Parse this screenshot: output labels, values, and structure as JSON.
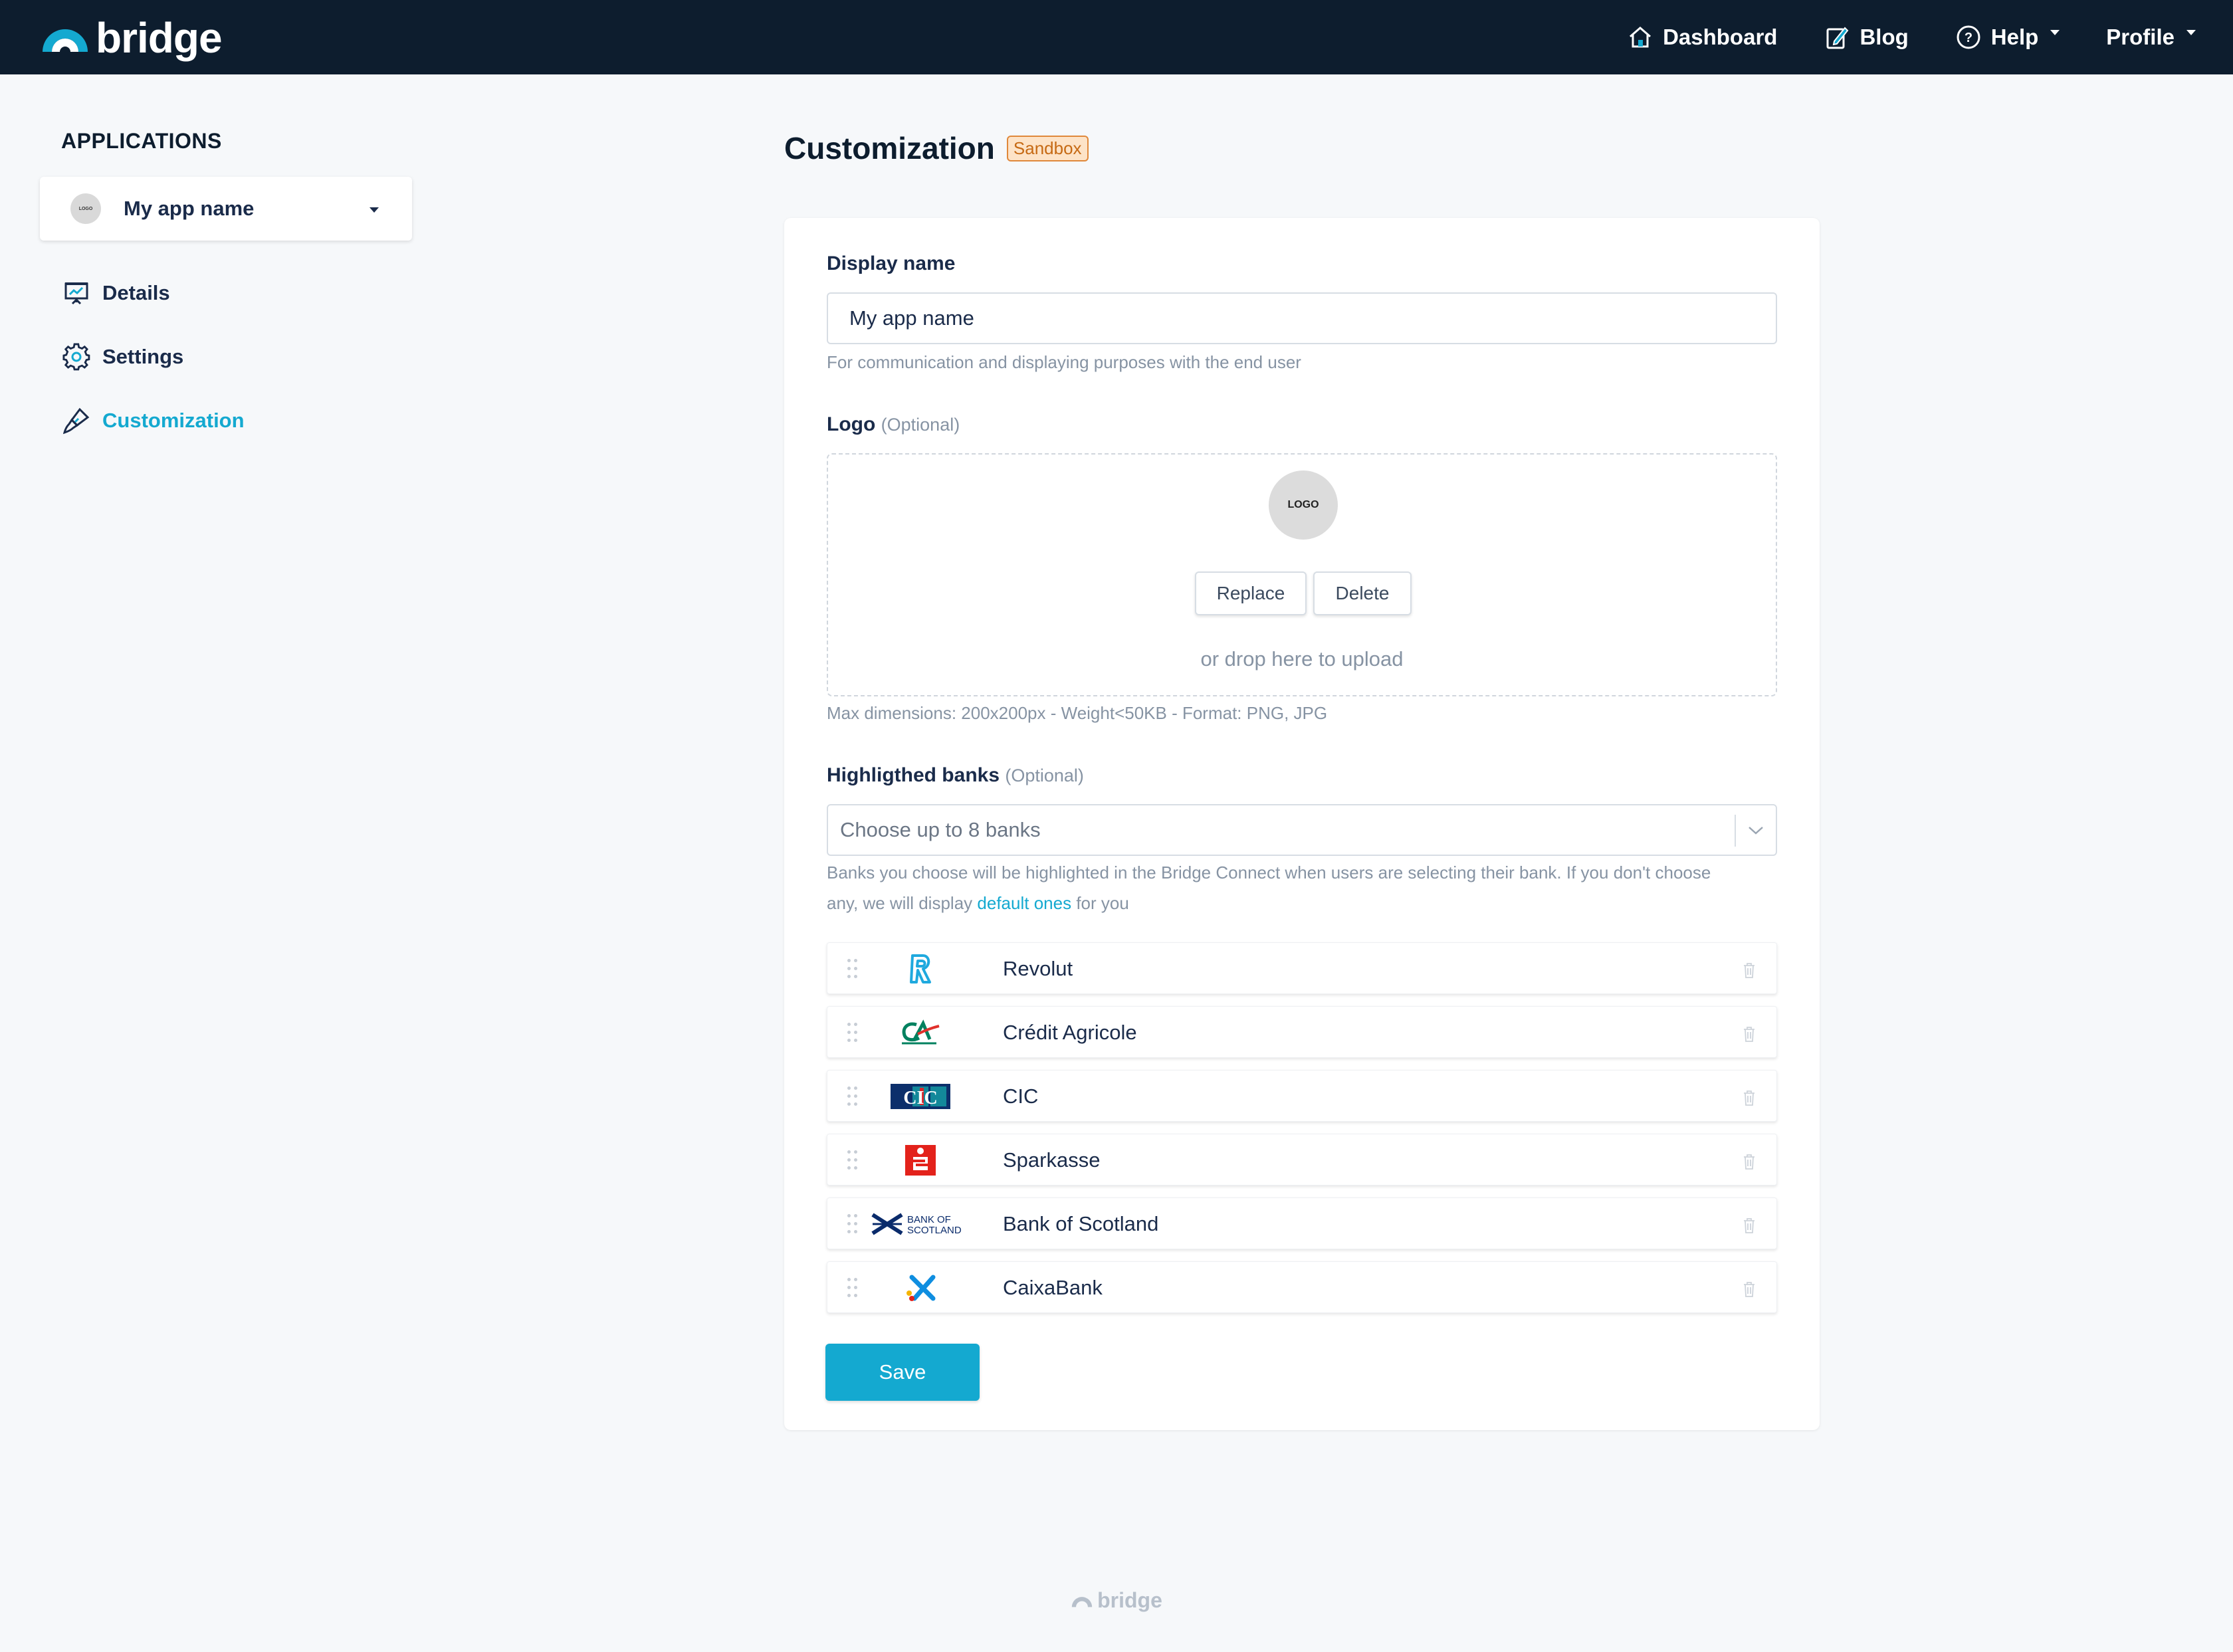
{
  "brand": {
    "name": "bridge"
  },
  "nav": {
    "dashboard": "Dashboard",
    "blog": "Blog",
    "help": "Help",
    "profile": "Profile"
  },
  "sidebar": {
    "heading": "APPLICATIONS",
    "app_logo_text": "LOGO",
    "selected_app": "My app name",
    "links": {
      "details": "Details",
      "settings": "Settings",
      "customization": "Customization"
    },
    "active": "Customization"
  },
  "page": {
    "title": "Customization",
    "badge": "Sandbox"
  },
  "form": {
    "display_name": {
      "label": "Display name",
      "value": "My app name",
      "help": "For communication and displaying purposes with the end user"
    },
    "logo": {
      "label": "Logo",
      "optional": "(Optional)",
      "placeholder_text": "LOGO",
      "replace": "Replace",
      "delete": "Delete",
      "drop_text": "or drop here to upload",
      "help": "Max dimensions: 200x200px - Weight<50KB - Format: PNG, JPG"
    },
    "banks": {
      "label": "Highligthed banks",
      "optional": "(Optional)",
      "placeholder": "Choose up to 8 banks",
      "help_line1": "Banks you choose will be highlighted in the Bridge Connect when users are selecting their bank. If you don't choose",
      "help_line2_pre": "any, we will display",
      "help_link": "default ones",
      "help_line2_post": "for you",
      "items": [
        {
          "name": "Revolut"
        },
        {
          "name": "Crédit Agricole"
        },
        {
          "name": "CIC",
          "logo_text": "CIC"
        },
        {
          "name": "Sparkasse"
        },
        {
          "name": "Bank of Scotland",
          "logo_text_1": "BANK OF",
          "logo_text_2": "SCOTLAND"
        },
        {
          "name": "CaixaBank"
        }
      ]
    },
    "save": "Save"
  },
  "footer": {
    "text": "bridge"
  },
  "colors": {
    "accent": "#14a9d0",
    "nav_bg": "#0d1d2e",
    "badge_border": "#e0883a"
  }
}
